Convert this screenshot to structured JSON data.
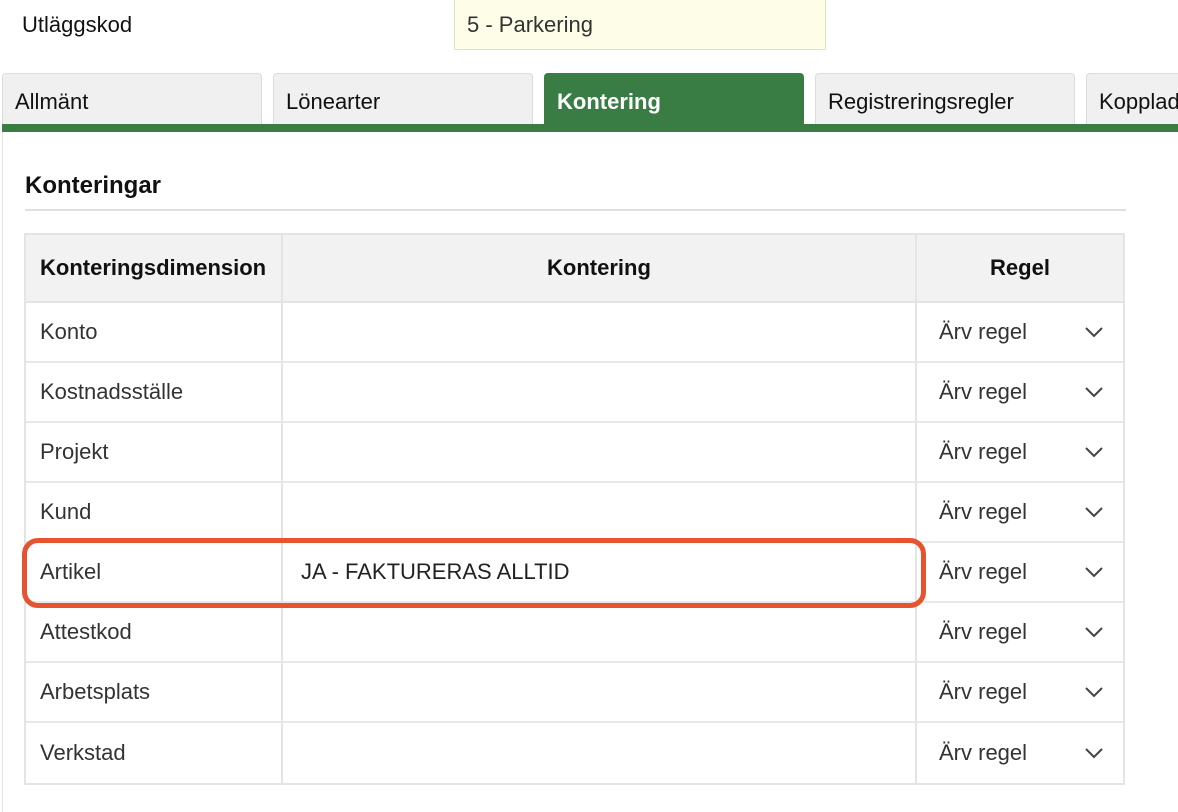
{
  "header": {
    "code_label": "Utläggskod",
    "code_value": "5 - Parkering"
  },
  "tabs": [
    {
      "label": "Allmänt",
      "active": false
    },
    {
      "label": "Lönearter",
      "active": false
    },
    {
      "label": "Kontering",
      "active": true
    },
    {
      "label": "Registreringsregler",
      "active": false
    },
    {
      "label": "Kopplad",
      "active": false
    }
  ],
  "section": {
    "title": "Konteringar"
  },
  "table": {
    "columns": [
      "Konteringsdimension",
      "Kontering",
      "Regel"
    ],
    "rows": [
      {
        "dimension": "Konto",
        "kontering": "",
        "regel": "Ärv regel"
      },
      {
        "dimension": "Kostnadsställe",
        "kontering": "",
        "regel": "Ärv regel"
      },
      {
        "dimension": "Projekt",
        "kontering": "",
        "regel": "Ärv regel"
      },
      {
        "dimension": "Kund",
        "kontering": "",
        "regel": "Ärv regel"
      },
      {
        "dimension": "Artikel",
        "kontering": "JA - FAKTURERAS ALLTID",
        "regel": "Ärv regel"
      },
      {
        "dimension": "Attestkod",
        "kontering": "",
        "regel": "Ärv regel"
      },
      {
        "dimension": "Arbetsplats",
        "kontering": "",
        "regel": "Ärv regel"
      },
      {
        "dimension": "Verkstad",
        "kontering": "",
        "regel": "Ärv regel"
      }
    ]
  },
  "colors": {
    "accent": "#3a7d44",
    "highlight": "#e5542f"
  },
  "icons": {
    "dropdown": "chevron-down-icon"
  }
}
